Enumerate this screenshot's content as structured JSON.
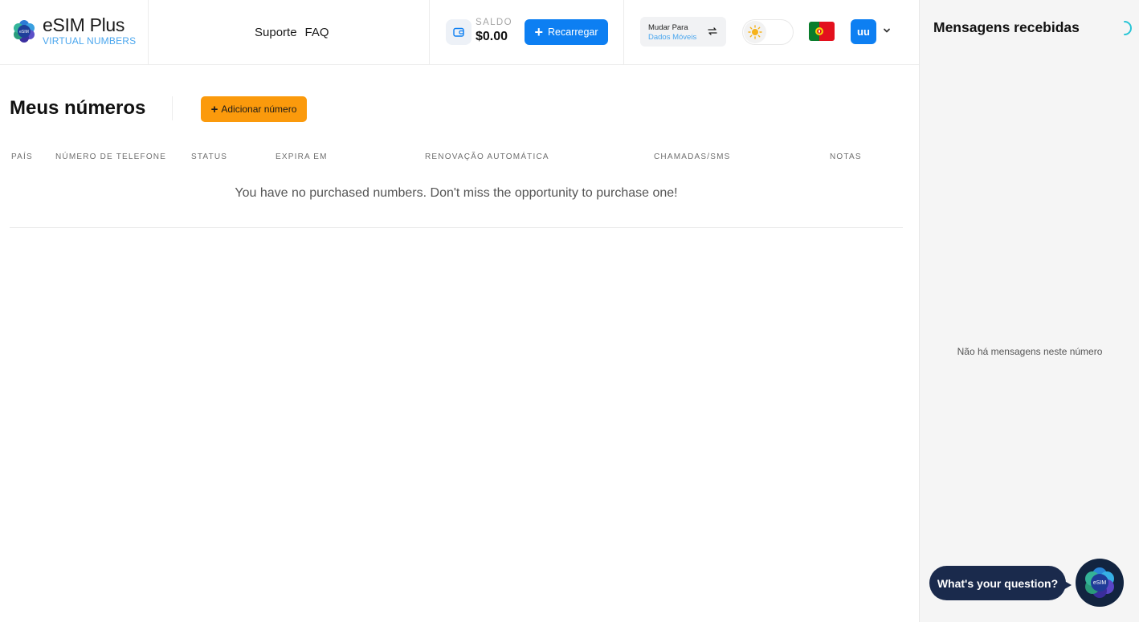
{
  "brand": {
    "title": "eSIM Plus",
    "subtitle": "VIRTUAL NUMBERS",
    "badge": "eSIM"
  },
  "nav": {
    "support": "Suporte",
    "faq": "FAQ"
  },
  "balance": {
    "label": "SALDO",
    "value": "$0.00"
  },
  "recharge_button": "Recarregar",
  "switch": {
    "line1": "Mudar Para",
    "line2": "Dados Móveis"
  },
  "theme": {
    "mode": "light",
    "icon": "sun-icon"
  },
  "language": {
    "flag": "portugal-flag"
  },
  "user": {
    "initials": "uu"
  },
  "page": {
    "title": "Meus números",
    "add_button": "Adicionar número"
  },
  "table": {
    "columns": [
      "PAÍS",
      "NÚMERO DE TELEFONE",
      "STATUS",
      "EXPIRA EM",
      "RENOVAÇÃO AUTOMÁTICA",
      "CHAMADAS/SMS",
      "NOTAS"
    ],
    "rows": [],
    "empty_message": "You have no purchased numbers. Don't miss the opportunity to purchase one!"
  },
  "messages": {
    "title": "Mensagens recebidas",
    "empty": "Não há mensagens neste número"
  },
  "chat": {
    "prompt": "What's your question?",
    "badge": "eSIM"
  },
  "colors": {
    "primary": "#0d7ff2",
    "accent": "#fb9a0c",
    "link": "#4aa6ee",
    "chat_bg": "#1a2a4c"
  }
}
